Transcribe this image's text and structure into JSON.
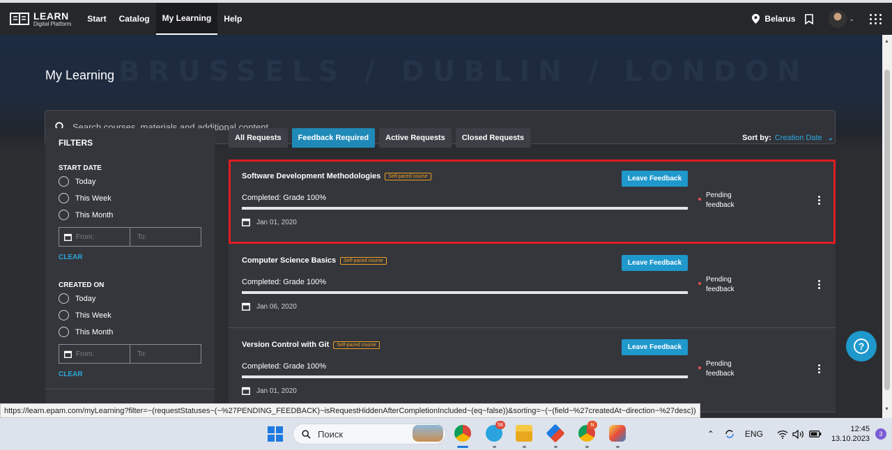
{
  "nav": {
    "logo_title": "LEARN",
    "logo_subtitle": "Digital Platform",
    "links": [
      "Start",
      "Catalog",
      "My Learning",
      "Help"
    ],
    "active_link": "My Learning",
    "location": "Belarus"
  },
  "page": {
    "title": "My Learning",
    "search_placeholder": "Search courses, materials and additional content"
  },
  "filters": {
    "title": "FILTERS",
    "groups": [
      {
        "title": "START DATE",
        "options": [
          "Today",
          "This Week",
          "This Month"
        ],
        "from": "From:",
        "to": "To:",
        "clear": "CLEAR"
      },
      {
        "title": "CREATED ON",
        "options": [
          "Today",
          "This Week",
          "This Month"
        ],
        "from": "From:",
        "to": "To:",
        "clear": "CLEAR"
      }
    ]
  },
  "tabs": [
    "All Requests",
    "Feedback Required",
    "Active Requests",
    "Closed Requests"
  ],
  "active_tab": "Feedback Required",
  "sort": {
    "label": "Sort by:",
    "value": "Creation Date"
  },
  "cards": [
    {
      "title": "Software Development Methodologies",
      "badge": "Self-paced course",
      "completed": "Completed: Grade 100%",
      "progress": 1.0,
      "date": "Jan 01, 2020",
      "button": "Leave Feedback",
      "status_line1": "Pending",
      "status_line2": "feedback",
      "highlighted": true
    },
    {
      "title": "Computer Science Basics",
      "badge": "Self-paced course",
      "completed": "Completed: Grade 100%",
      "progress": 1.0,
      "date": "Jan 06, 2020",
      "button": "Leave Feedback",
      "status_line1": "Pending",
      "status_line2": "feedback",
      "highlighted": false
    },
    {
      "title": "Version Control with Git",
      "badge": "Self-paced course",
      "completed": "Completed: Grade 100%",
      "progress": 1.0,
      "date": "Jan 01, 2020",
      "button": "Leave Feedback",
      "status_line1": "Pending",
      "status_line2": "feedback",
      "highlighted": false
    }
  ],
  "status_url": "https://learn.epam.com/myLearning?filter=~(requestStatuses~(~%27PENDING_FEEDBACK)~isRequestHiddenAfterCompletionIncluded~(eq~false))&sorting=~(~(field~%27createdAt~direction~%27desc))",
  "taskbar": {
    "search_label": "Поиск",
    "telegram_badge": "58",
    "lang": "ENG",
    "time": "12:45",
    "date": "13.10.2023",
    "notifications": "3"
  },
  "colors": {
    "accent": "#1f98cc",
    "highlight": "#e01d24",
    "badge": "#f0a021"
  }
}
